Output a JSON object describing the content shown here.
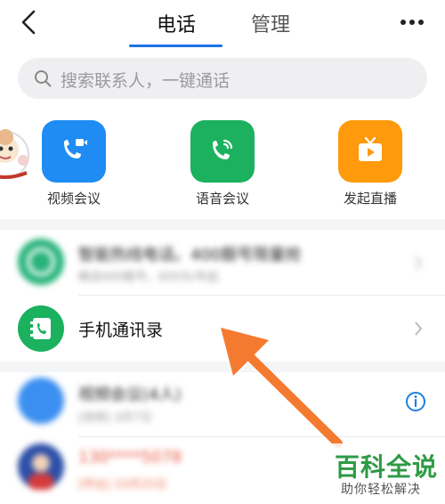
{
  "header": {
    "tabs": [
      {
        "label": "电话",
        "active": true
      },
      {
        "label": "管理",
        "active": false
      }
    ]
  },
  "search": {
    "placeholder": "搜索联系人，一键通话"
  },
  "quick_actions": [
    {
      "label": "视频会议",
      "icon": "video-call-icon",
      "color": "#1e8cf3"
    },
    {
      "label": "语音会议",
      "icon": "voice-call-icon",
      "color": "#1bb15e"
    },
    {
      "label": "发起直播",
      "icon": "live-tv-icon",
      "color": "#fe9a0b"
    }
  ],
  "list": {
    "hotline": {
      "title": "智能热线电话。400靓号限量抢",
      "subtitle": "精选400靓号，600元/年起"
    },
    "address_book": {
      "label": "手机通讯录"
    },
    "contacts": [
      {
        "title": "视频会议(4人)",
        "subtitle": "[视频] 3月7日"
      },
      {
        "title": "130****5078",
        "subtitle": "[呼出] 10月25日"
      }
    ]
  },
  "watermark": {
    "title": "百科全说",
    "subtitle": "助你轻松解决"
  },
  "colors": {
    "accent_blue": "#1a73e8",
    "green": "#1bb15e",
    "orange": "#fe9a0b",
    "arrow": "#f47a30"
  }
}
